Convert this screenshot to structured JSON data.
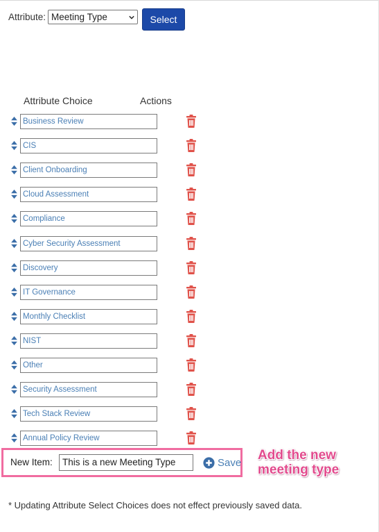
{
  "attribute": {
    "label": "Attribute:",
    "selected": "Meeting Type",
    "select_button": "Select"
  },
  "table": {
    "header_choice": "Attribute Choice",
    "header_actions": "Actions",
    "choices": [
      "Business Review",
      "CIS",
      "Client Onboarding",
      "Cloud Assessment",
      "Compliance",
      "Cyber Security Assessment",
      "Discovery",
      "IT Governance",
      "Monthly Checklist",
      "NIST",
      "Other",
      "Security Assessment",
      "Tech Stack Review",
      "Annual Policy Review"
    ]
  },
  "new_item": {
    "label": "New Item:",
    "value": "This is a new Meeting Type",
    "save_label": "Save"
  },
  "annotation": {
    "text_line1": "Add the new",
    "text_line2": "meeting type",
    "color": "#e24a8d"
  },
  "footnote": "* Updating Attribute Select Choices does not effect previously saved data.",
  "colors": {
    "button_blue": "#1c49a8",
    "link_blue": "#4a7fb5",
    "trash_red": "#e0524a",
    "highlight_pink": "#f06ca0"
  },
  "icons": {
    "sort": "sort-icon",
    "delete": "trash-icon",
    "add": "plus-circle-icon",
    "dropdown": "chevron-down-icon"
  }
}
